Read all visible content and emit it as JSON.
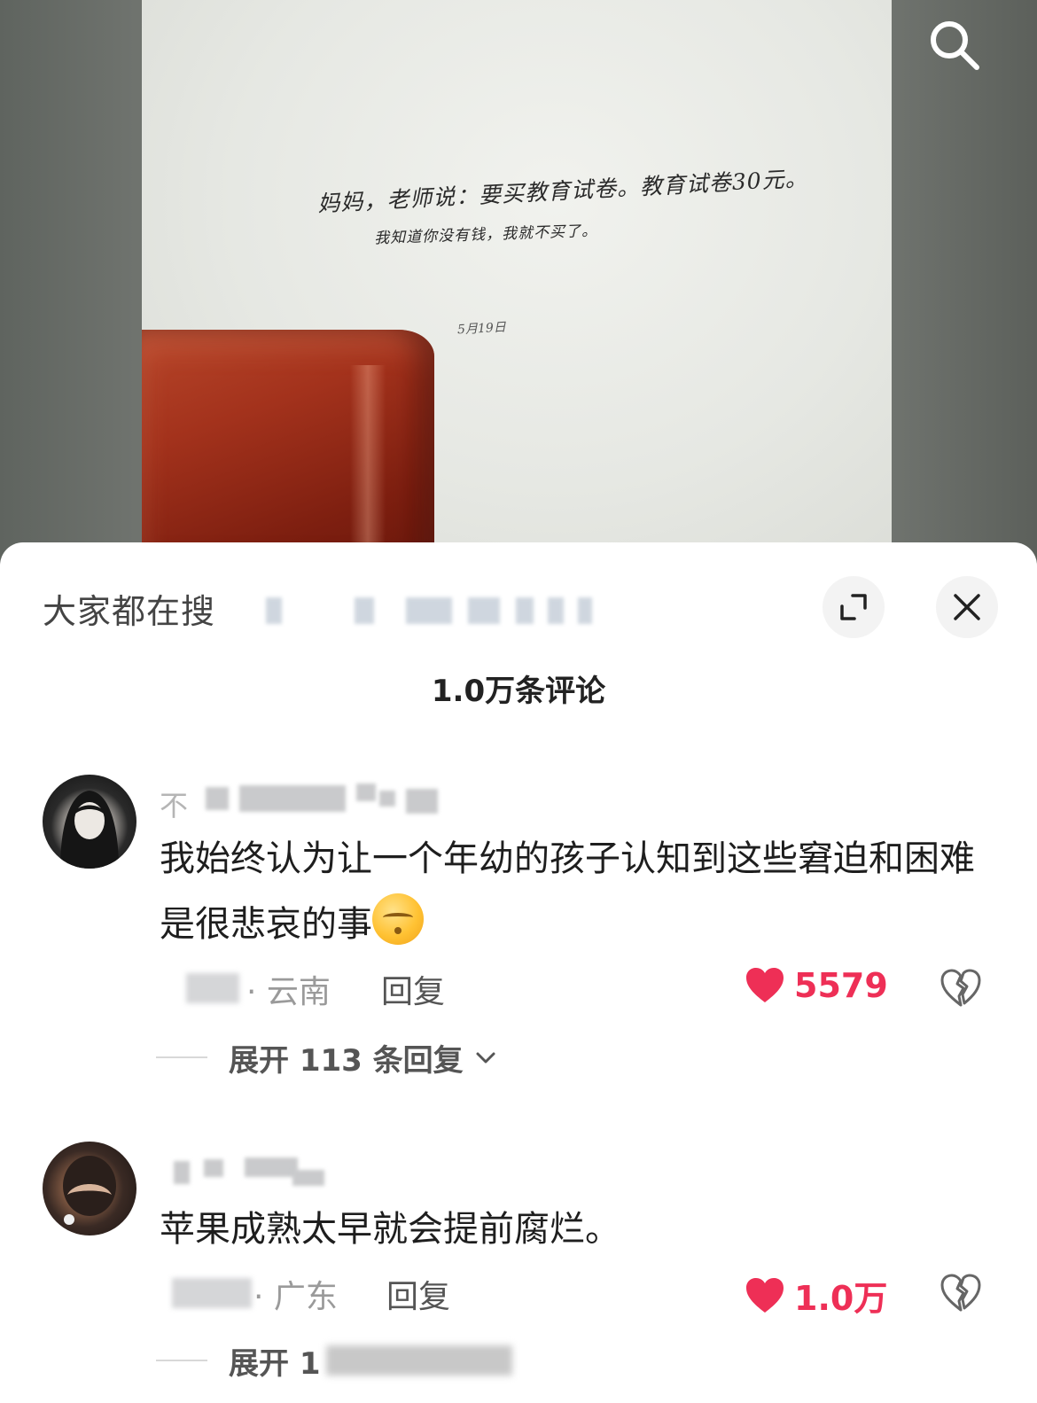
{
  "video": {
    "note_line1": "妈妈，老师说：要买教育试卷。教育试卷30元。",
    "note_line2": "我知道你没有钱，我就不买了。",
    "note_date": "5月19日"
  },
  "sheet": {
    "search_prefix": "大家都在搜",
    "comments_count": "1.0万条评论"
  },
  "comments": [
    {
      "username_prefix": "不",
      "text": "我始终认为让一个年幼的孩子认知到这些窘迫和困难是很悲哀的事",
      "location": "· 云南",
      "reply_label": "回复",
      "likes": "5579",
      "expand_label": "展开 113 条回复"
    },
    {
      "text": "苹果成熟太早就会提前腐烂。",
      "location": "· 广东",
      "reply_label": "回复",
      "likes": "1.0万",
      "expand_label": "展开 1"
    }
  ],
  "colors": {
    "like_red": "#ee2f56",
    "text_dark": "#1e1e1e",
    "text_muted": "#9a9a9a"
  },
  "icons": [
    "search-icon",
    "expand-icon",
    "close-icon",
    "heart-icon",
    "broken-heart-icon",
    "chevron-down-icon"
  ]
}
